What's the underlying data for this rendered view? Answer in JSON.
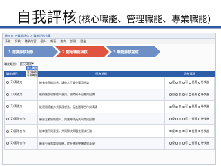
{
  "slide": {
    "title_main": "自我評核",
    "title_sub": "(核心職能、管理職能、專業職能)"
  },
  "app": {
    "breadcrumb": "Home > 職能評估 > 職能評核作業",
    "menu": [
      "系統",
      "評核",
      "職務內容",
      "個人",
      "報表",
      "查詢",
      "說明",
      "登出"
    ]
  },
  "steps": [
    {
      "label": "1.選擇評核對象"
    },
    {
      "label": "2.開始職能評核"
    },
    {
      "label": "3.職能評核完成"
    }
  ],
  "filter": {
    "label": "職能類別：",
    "selected": "核心職能",
    "options": [
      "核心職能",
      "管理職能",
      "專業職能"
    ]
  },
  "table": {
    "headers": [
      "職能項目",
      "行為指標",
      "評核選項"
    ],
    "rows": [
      {
        "ability": "(1)溝通力",
        "description": "能有效傳遞訊息，讓他人了解並獲得共識"
      },
      {
        "ability": "(1)溝通力",
        "description": "能傾聽並理解他人意見，適時給予回應與回饋"
      },
      {
        "ability": "(1)溝通力",
        "description": "能運用適當方式表達想法，促進團隊合作與溝通"
      },
      {
        "ability": "(2)團隊合作",
        "description": "願意主動協助他人，與團隊成員共同完成目標"
      },
      {
        "ability": "(2)團隊合作",
        "description": "能尊重不同意見，共同解決問題並達成任務"
      },
      {
        "ability": "(2)團隊合作",
        "description": "願意分享知識與經驗，提升團隊整體績效表現"
      }
    ],
    "rating_options": [
      "優",
      "良",
      "可",
      "普通",
      "待改進"
    ]
  }
}
